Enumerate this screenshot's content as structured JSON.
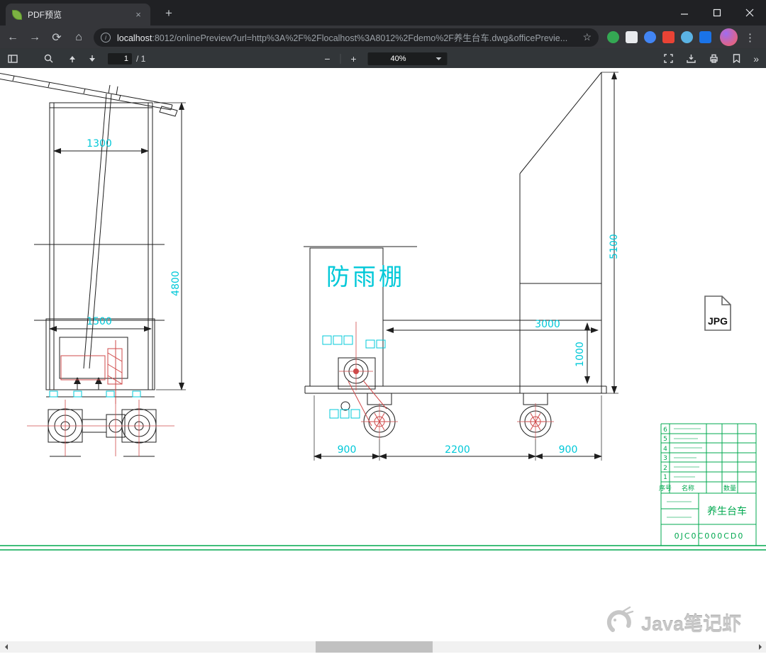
{
  "window": {
    "tab_title": "PDF预览",
    "new_tab_label": "+"
  },
  "address_bar": {
    "url_host": "localhost",
    "url_rest": ":8012/onlinePreview?url=http%3A%2F%2Flocalhost%3A8012%2Fdemo%2F养生台车.dwg&officePrevie..."
  },
  "pdf_toolbar": {
    "page_value": "1",
    "page_total": "/ 1",
    "zoom_value": "40%",
    "zoom_out_label": "−",
    "zoom_in_label": "+",
    "more_label": "»"
  },
  "drawing": {
    "shelter_label": "防雨棚",
    "dims": {
      "left_width": "1300",
      "left_height": "4800",
      "left_inner_width": "1500",
      "bed_length": "3000",
      "bed_height": "1000",
      "right_height": "5100",
      "front_span": "900",
      "middle_span": "2200",
      "rear_span": "900"
    },
    "jpg_icon_label": "JPG",
    "title_block": {
      "index_header": "序号",
      "name_header": "名称",
      "qty_header": "数量",
      "row_numbers": [
        "6",
        "5",
        "4",
        "3",
        "2",
        "1"
      ],
      "title_cell": "养生台车",
      "code_cell": "0JC0C000CD0"
    }
  },
  "watermark": {
    "text": "Java笔记虾"
  },
  "colors": {
    "dimension_cyan": "#00c8d8",
    "annotation_red": "#cf4a4a",
    "table_green": "#00a84f"
  }
}
